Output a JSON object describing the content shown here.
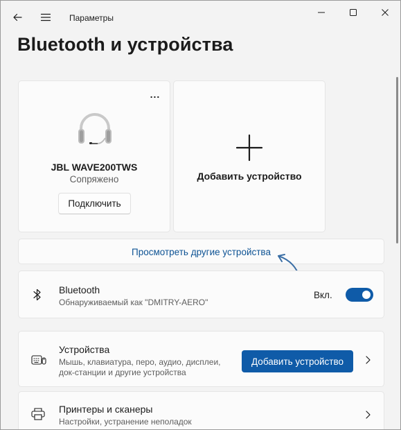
{
  "titlebar": {
    "app_title": "Параметры"
  },
  "page": {
    "title": "Bluetooth и устройства"
  },
  "device_card": {
    "name": "JBL WAVE200TWS",
    "status": "Сопряжено",
    "connect_label": "Подключить",
    "more_label": "..."
  },
  "add_card": {
    "label": "Добавить устройство"
  },
  "view_more": {
    "label": "Просмотреть другие устройства"
  },
  "bluetooth_row": {
    "title": "Bluetooth",
    "subtitle": "Обнаруживаемый как \"DMITRY-AERO\"",
    "toggle_label": "Вкл.",
    "toggle_on": true
  },
  "devices_row": {
    "title": "Устройства",
    "subtitle_line1": "Мышь, клавиатура, перо, аудио, дисплеи,",
    "subtitle_line2": "док-станции и другие устройства",
    "button_label": "Добавить устройство"
  },
  "printers_row": {
    "title": "Принтеры и сканеры",
    "subtitle": "Настройки, устранение неполадок"
  },
  "colors": {
    "accent": "#0f5ba8",
    "link": "#0e5394",
    "annotation_arrow": "#3a6ea5"
  }
}
